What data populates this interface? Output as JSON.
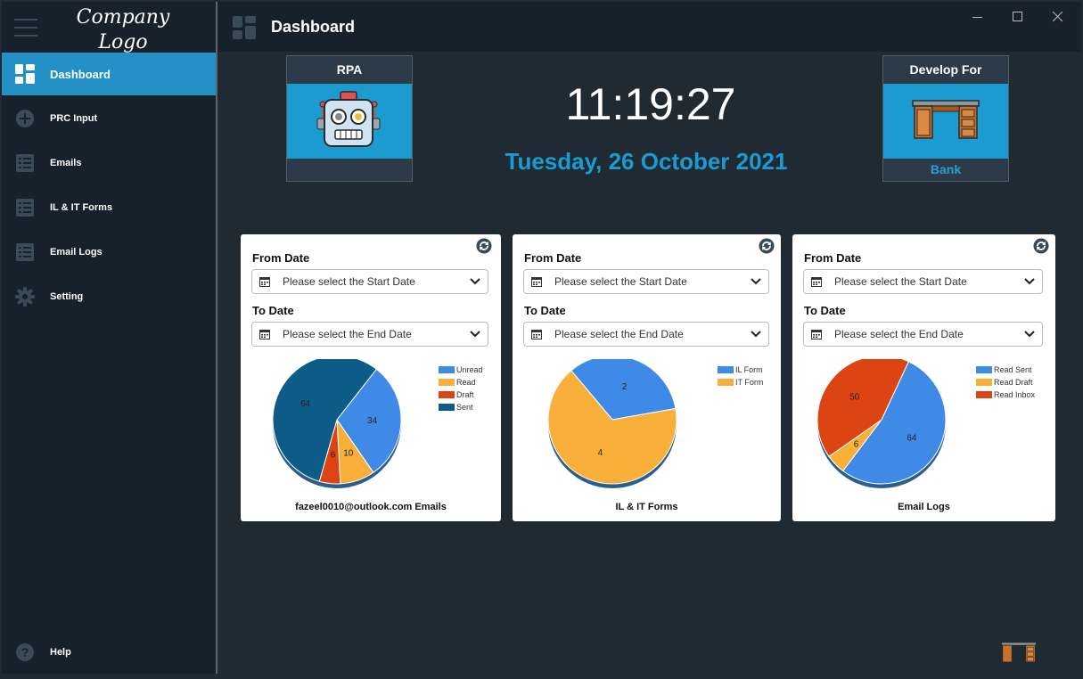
{
  "sidebar": {
    "logo_line1": "Company",
    "logo_line2": "Logo",
    "items": [
      {
        "label": "Dashboard",
        "icon": "dashboard-icon",
        "active": true
      },
      {
        "label": "PRC Input",
        "icon": "plus-circle-icon"
      },
      {
        "label": "Emails",
        "icon": "list-icon"
      },
      {
        "label": "IL & IT Forms",
        "icon": "list-icon"
      },
      {
        "label": "Email Logs",
        "icon": "list-icon"
      },
      {
        "label": "Setting",
        "icon": "gear-icon"
      }
    ],
    "help_label": "Help"
  },
  "header": {
    "title": "Dashboard"
  },
  "rpa_box": {
    "title": "RPA",
    "icon": "robot-icon"
  },
  "develop_box": {
    "title": "Develop For",
    "icon": "desk-icon",
    "value": "Bank"
  },
  "clock": {
    "time": "11:19:27",
    "date": "Tuesday, 26 October 2021"
  },
  "cards": [
    {
      "from_label": "From Date",
      "from_placeholder": "Please select the Start Date",
      "to_label": "To Date",
      "to_placeholder": "Please select the End Date",
      "caption": "fazeel0010@outlook.com Emails"
    },
    {
      "from_label": "From Date",
      "from_placeholder": "Please select the Start Date",
      "to_label": "To Date",
      "to_placeholder": "Please select the End Date",
      "caption": "IL & IT Forms"
    },
    {
      "from_label": "From Date",
      "from_placeholder": "Please select the Start Date",
      "to_label": "To Date",
      "to_placeholder": "Please select the End Date",
      "caption": "Email Logs"
    }
  ],
  "colors": {
    "accent": "#2491c6",
    "blue": "#3f8ae6",
    "yellow": "#f8b03a",
    "red": "#dc4513",
    "navy": "#0d5b87"
  },
  "chart_data": [
    {
      "type": "pie",
      "categories": [
        "Unread",
        "Read",
        "Draft",
        "Sent"
      ],
      "values": [
        34,
        10,
        6,
        64
      ],
      "colors": [
        "#3f8ae6",
        "#f8b03a",
        "#dc4513",
        "#0d5b87"
      ],
      "title": "fazeel0010@outlook.com Emails",
      "legend": "top-right"
    },
    {
      "type": "pie",
      "categories": [
        "IL Form",
        "IT Form"
      ],
      "values": [
        2,
        4
      ],
      "colors": [
        "#3f8ae6",
        "#f8b03a"
      ],
      "title": "IL & IT Forms",
      "legend": "top-right"
    },
    {
      "type": "pie",
      "categories": [
        "Read Sent",
        "Read Draft",
        "Read Inbox"
      ],
      "values": [
        64,
        6,
        50
      ],
      "colors": [
        "#3f8ae6",
        "#f8b03a",
        "#dc4513"
      ],
      "title": "Email Logs",
      "legend": "top-right"
    }
  ]
}
